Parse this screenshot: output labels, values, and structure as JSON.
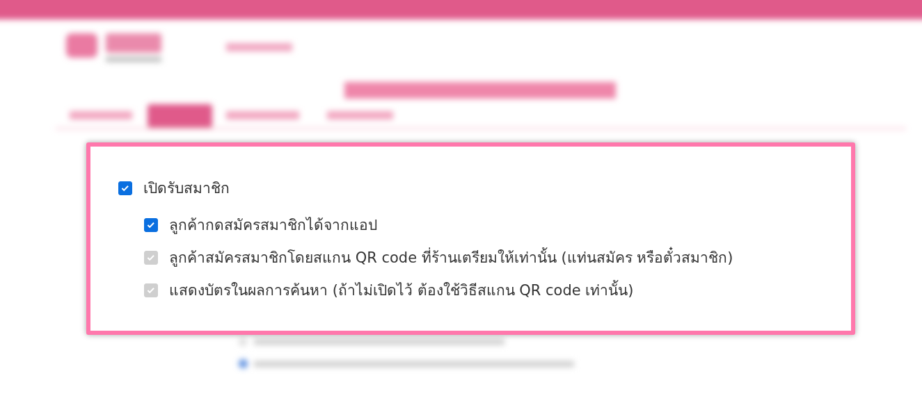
{
  "membership_settings": {
    "label": "เปิดรับสมาชิก",
    "checked": true,
    "disabled": false,
    "children": [
      {
        "label": "ลูกค้ากดสมัครสมาชิกได้จากแอป",
        "checked": true,
        "disabled": false
      },
      {
        "label": "ลูกค้าสมัครสมาชิกโดยสแกน QR code ที่ร้านเตรียมให้เท่านั้น (แท่นสมัคร หรือตั๋วสมาชิก)",
        "checked": true,
        "disabled": true
      },
      {
        "label": "แสดงบัตรในผลการค้นหา (ถ้าไม่เปิดไว้ ต้องใช้วิธีสแกน QR code เท่านั้น)",
        "checked": true,
        "disabled": true
      }
    ]
  }
}
